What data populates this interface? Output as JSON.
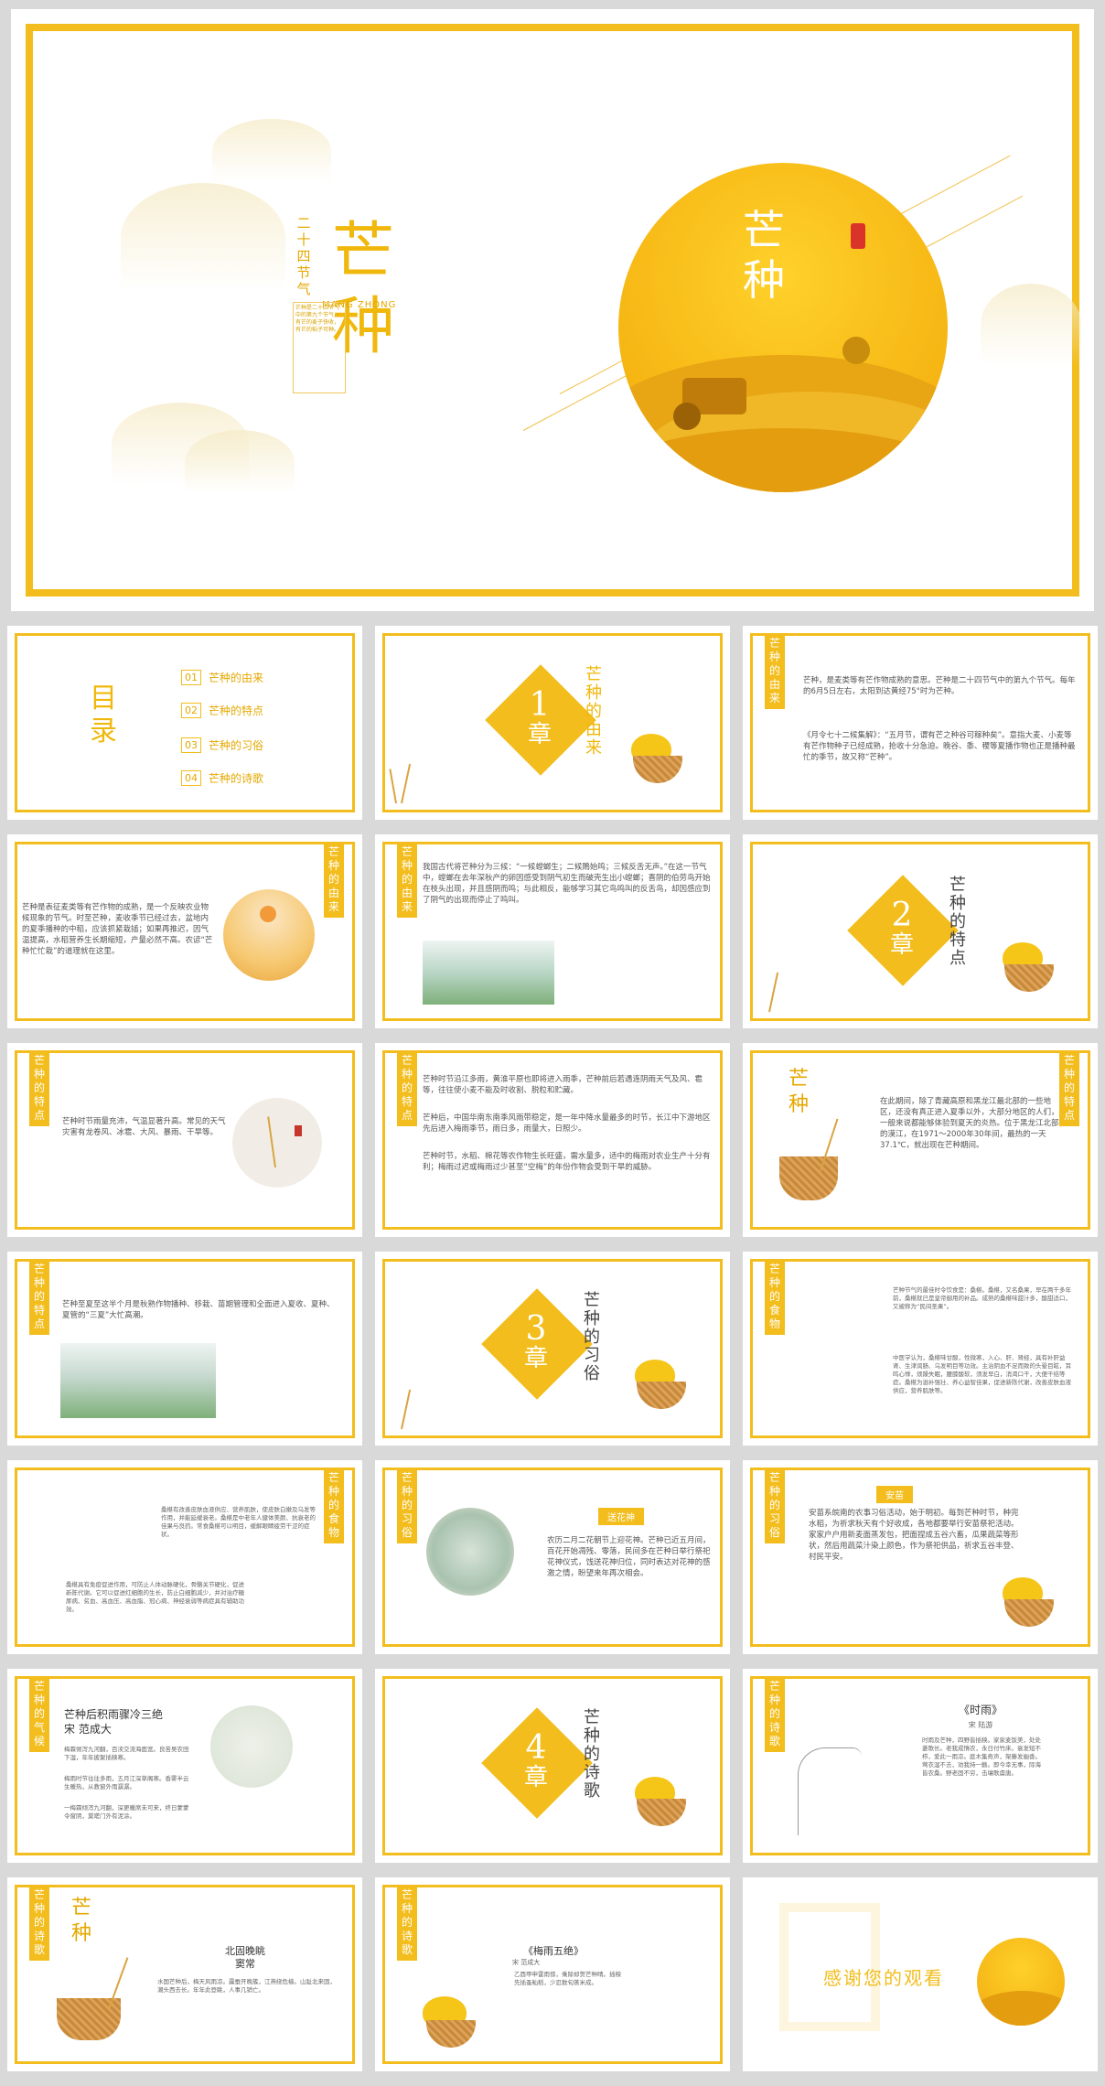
{
  "hero": {
    "vertical_title": "二\n十\n四\n节\n气",
    "big_title": "芒\n种",
    "pinyin": "MANG ZHONG",
    "side_text": "芒种是二十四节气中的第九个节气，有芒的麦子快收，有芒的稻子可种。",
    "sun_title": "芒\n种",
    "seal_text": "节气"
  },
  "colors": {
    "accent": "#f2bd1d",
    "text": "#555555"
  },
  "slides": {
    "toc": {
      "title": "目\n录",
      "items": [
        {
          "num": "01",
          "label": "芒种的由来"
        },
        {
          "num": "02",
          "label": "芒种的特点"
        },
        {
          "num": "03",
          "label": "芒种的习俗"
        },
        {
          "num": "04",
          "label": "芒种的诗歌"
        }
      ]
    },
    "ch1": {
      "num": "1",
      "word": "章",
      "title": "芒\n种\n的\n由\n来"
    },
    "s3": {
      "tag": "芒\n种\n的\n由\n来",
      "p1": "芒种，是麦类等有芒作物成熟的意思。芒种是二十四节气中的第九个节气。每年的6月5日左右，太阳到达黄经75°时为芒种。",
      "p2": "《月令七十二候集解》：“五月节，谓有芒之种谷可稼种矣”。意指大麦、小麦等有芒作物种子已经成熟，抢收十分急迫。晚谷、黍、稷等夏播作物也正是播种最忙的季节，故又称“芒种”。"
    },
    "s4": {
      "tag": "芒\n种\n的\n由\n来",
      "p1": "芒种是表征麦类等有芒作物的成熟，是一个反映农业物候现象的节气。时至芒种，麦收季节已经过去，盆地内的夏季播种的中稻，应该抓紧栽插；如果再推迟，因气温提高，水稻营养生长期缩短，产量必然不高。农谚“芒种忙忙栽”的道理就在这里。"
    },
    "s5": {
      "tag": "芒\n种\n的\n由\n来",
      "p1": "我国古代将芒种分为三候：“一候螳螂生；二候鵙始鸣；三候反舌无声。”在这一节气中，螳螂在去年深秋产的卵因感受到阴气初生而破壳生出小螳螂；喜阴的伯劳鸟开始在枝头出现，并且感阴而鸣；与此相反，能够学习其它鸟鸣叫的反舌鸟，却因感应到了阴气的出现而停止了鸣叫。"
    },
    "ch2": {
      "num": "2",
      "word": "章",
      "title": "芒\n种\n的\n特\n点"
    },
    "s7": {
      "tag": "芒\n种\n的\n特\n点",
      "p1": "芒种时节雨量充沛，气温显著升高。常见的天气灾害有龙卷风、冰雹、大风、暴雨、干旱等。"
    },
    "s8": {
      "tag": "芒\n种\n的\n特\n点",
      "p1": "芒种时节沿江多雨，黄淮平原也即将进入雨季，芒种前后若遇连阴雨天气及风、雹等，往往使小麦不能及时收割、脱粒和贮藏。",
      "p2": "芒种后，中国华南东南季风雨带稳定，是一年中降水量最多的时节，长江中下游地区先后进入梅雨季节，雨日多，雨量大，日照少。",
      "p3": "芒种时节，水稻、棉花等农作物生长旺盛，需水量多，适中的梅雨对农业生产十分有利；梅雨过迟或梅雨过少甚至“空梅”的年份作物会受到干旱的威胁。"
    },
    "s9": {
      "tag": "芒\n种\n的\n特\n点",
      "mini_title": "芒\n种",
      "p1": "在此期间，除了青藏高原和黑龙江最北部的一些地区，还没有真正进入夏季以外，大部分地区的人们，一般来说都能够体验到夏天的炎热。位于黑龙江北部的漠江，在1971～2000年30年间，最热的一天37.1℃，就出现在芒种期间。"
    },
    "s10": {
      "tag": "芒\n种\n的\n特\n点",
      "p1": "芒种至夏至这半个月是秋熟作物播种、移栽、苗期管理和全面进入夏收、夏种、夏管的“三夏”大忙高潮。"
    },
    "ch3": {
      "num": "3",
      "word": "章",
      "title": "芒\n种\n的\n习\n俗"
    },
    "s12": {
      "tag": "芒\n种\n的\n食\n物",
      "p1": "芒种节气的最佳时令饮食是：桑椹。桑椹，又名桑果，早在两千多年前，桑椹就已是皇帝御用的补品。成熟的桑椹味甜汁多，酸甜适口，又被称为“民间圣果”。",
      "p2": "中医学认为，桑椹味甘酸，性微寒，入心、肝、肾经，具有补肝益肾、生津润肠、乌发明目等功效。主治阴血不足而致的头晕目眩，耳鸣心悸，烦躁失眠，腰膝酸软，须发早白，消渴口干，大便干结等症。桑椹为滋补强壮、养心益智佳果，促进新陈代谢，改善皮肤血液供应，营养肌肤等。"
    },
    "s13": {
      "tag": "芒\n种\n的\n食\n物",
      "p1": "桑椹有改善皮肤血液供应、营养肌肤，使皮肤白嫩及乌发等作用，并能延缓衰老。桑椹是中老年人健体美颜、抗衰老的佳果与良药。常食桑椹可以明目，缓解眼睛疲劳干涩的症状。",
      "p2": "桑椹具有免疫促进作用，可防止人体动脉硬化，骨骼关节硬化，促进新陈代谢。它可以促进红细胞的生长，防止白细胞减少，并对治疗糖尿病、贫血、高血压、高血脂、冠心病、神经衰弱等病症具有辅助功效。"
    },
    "s14": {
      "tag": "芒\n种\n的\n习\n俗",
      "label": "送花神",
      "p1": "农历二月二花朝节上迎花神。芒种已近五月间，百花开始凋残、零落，民间多在芒种日举行祭祀花神仪式，饯送花神归位，同时表达对花神的感激之情，盼望来年再次相会。"
    },
    "s15": {
      "tag": "芒\n种\n的\n习\n俗",
      "label": "安苗",
      "p1": "安苗系皖南的农事习俗活动，始于明初。每到芒种时节，种完水稻，为祈求秋天有个好收成，各地都要举行安苗祭祀活动。家家户户用新麦面蒸发包，把面捏成五谷六畜，瓜果蔬菜等形状，然后用蔬菜汁染上颜色，作为祭祀供品，祈求五谷丰登、村民平安。"
    },
    "s16": {
      "tag": "芒\n种\n的\n气\n候",
      "title": "芒种后积雨骤冷三绝\n宋 范成大",
      "p1": "梅霖倾泻九河翻，百渎交流海面宽。良苦吴农田下湿，年年披絮插秧寒。",
      "p2": "梅雨时节往往多雨，五月江深草阁寒。香雾半云生暖热，从教窗外雨潺潺。",
      "p3": "一梅霖倾泻九河翻，深更暖席未可来，终日蒙蒙令窗阴，莫嗟门外有泥涂。"
    },
    "ch4": {
      "num": "4",
      "word": "章",
      "title": "芒\n种\n的\n诗\n歌"
    },
    "s18": {
      "tag": "芒\n种\n的\n诗\n歌",
      "title": "《时雨》",
      "author": "宋 陆游",
      "p1": "时雨及芒种，四野皆插秧。家家麦饭美，处处菱歌长。老我成惰农，永日付竹床。衰发短不栉，爱此一雨凉。庭木集奇声，架藤发幽香。莺衣湿不去，劝我持一觞。即今幸无事，际海皆农桑。野老固不穷，击壤歌虞唐。"
    },
    "s19": {
      "tag": "芒\n种\n的\n诗\n歌",
      "mini_title": "芒\n种",
      "title": "北固晚眺\n窦常",
      "p1": "水国芒种后，梅天风雨凉。露蚕开晚簇，江燕绕危樯。山趾北来固，潮头西去长。年年此登眺，人事几销亡。"
    },
    "s20": {
      "tag": "芒\n种\n的\n诗\n歌",
      "title": "《梅雨五绝》",
      "author": "宋 范成大",
      "p1": "乙酉甲申雷雨惊，乘除却贺芒种晴。插秧先插蚤籼稻，少忍数旬蒸米成。"
    },
    "end": {
      "text": "感谢您的观看"
    }
  }
}
